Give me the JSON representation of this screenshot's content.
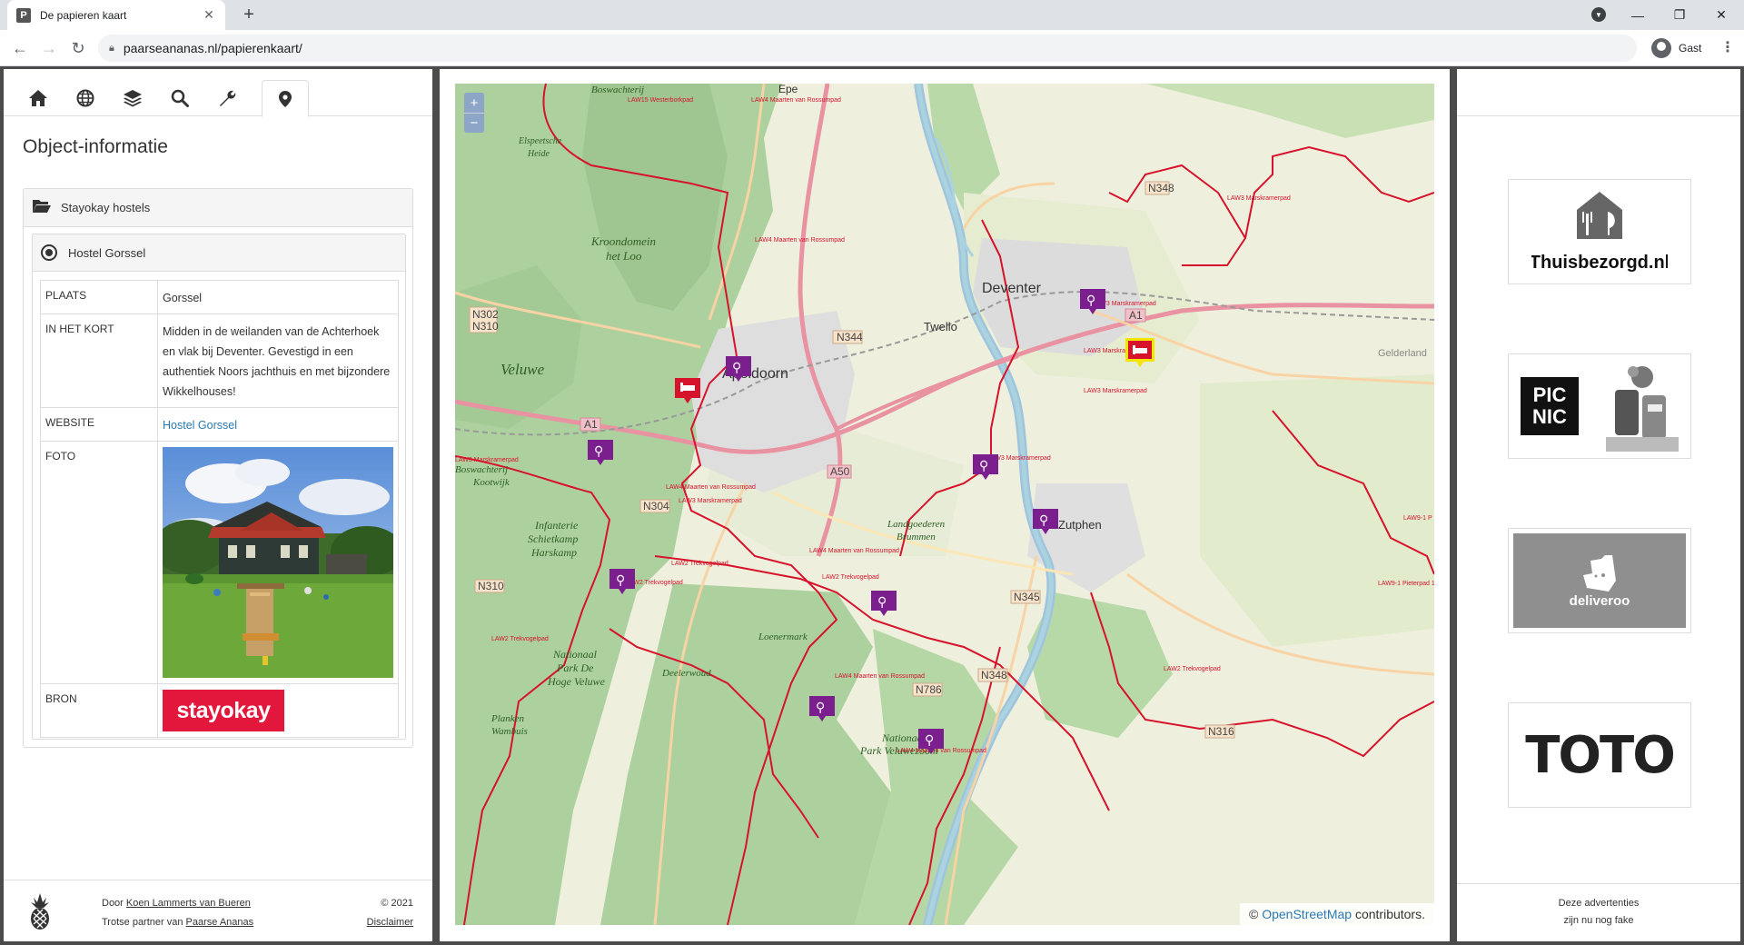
{
  "browser": {
    "tab_title": "De papieren kaart",
    "favicon_letter": "P",
    "url": "paarseananas.nl/papierenkaart/",
    "profile_name": "Gast"
  },
  "left_panel": {
    "tabs": [
      {
        "name": "home-icon"
      },
      {
        "name": "globe-icon"
      },
      {
        "name": "layers-icon"
      },
      {
        "name": "search-icon"
      },
      {
        "name": "wrench-icon"
      },
      {
        "name": "map-pin-icon",
        "active": true
      }
    ],
    "title": "Object-informatie",
    "category": "Stayokay hostels",
    "object_name": "Hostel Gorssel",
    "rows": {
      "plaats_key": "PLAATS",
      "plaats_value": "Gorssel",
      "kort_key": "IN HET KORT",
      "kort_value": "Midden in de weilanden van de Achterhoek en vlak bij Deventer. Gevestigd in een authentiek Noors jachthuis en met bijzondere Wikkelhouses!",
      "website_key": "WEBSITE",
      "website_value": "Hostel Gorssel",
      "foto_key": "FOTO",
      "bron_key": "BRON",
      "bron_logo": "stayokay"
    },
    "footer": {
      "door": "Door",
      "author": "Koen Lammerts van Bueren",
      "partner": "Trotse partner van",
      "partner_name": "Paarse Ananas",
      "year": "© 2021",
      "disclaimer": "Disclaimer"
    }
  },
  "map": {
    "zoom_in": "+",
    "zoom_out": "−",
    "attribution_prefix": "©",
    "attribution_link": "OpenStreetMap",
    "attribution_suffix": "contributors.",
    "places": [
      {
        "key": "epe",
        "label": "Epe"
      },
      {
        "key": "deventer",
        "label": "Deventer"
      },
      {
        "key": "twello",
        "label": "Twello"
      },
      {
        "key": "apeldoorn",
        "label": "Apeldoorn"
      },
      {
        "key": "zutphen",
        "label": "Zutphen"
      },
      {
        "key": "veluwe",
        "label": "Veluwe"
      },
      {
        "key": "gelderland",
        "label": "Gelderland"
      },
      {
        "key": "kroondomein",
        "label": "Kroondomein het Loo"
      },
      {
        "key": "elspeetsche",
        "label": "Elspeetsche Heide"
      },
      {
        "key": "infanterie",
        "label": "Infanterie Schietkamp Harskamp"
      },
      {
        "key": "nationaal",
        "label": "Nationaal Park De Hoge Veluwe"
      },
      {
        "key": "landgoederen",
        "label": "Landgoederen Brummen"
      },
      {
        "key": "loenermark",
        "label": "Loenermark"
      },
      {
        "key": "deelerwoud",
        "label": "Deelerwoud"
      },
      {
        "key": "planken",
        "label": "Planken Wambuis"
      },
      {
        "key": "kootwijk",
        "label": "Boswachterij Kootwijk"
      },
      {
        "key": "boswachterij",
        "label": "Boswachterij"
      },
      {
        "key": "nationaal2",
        "label": "Nationaal Park Veluwezoom"
      }
    ],
    "road_labels": [
      "N348",
      "N302",
      "N310",
      "N344",
      "A1",
      "A50",
      "N304",
      "N310",
      "N345",
      "N348",
      "N786",
      "N316",
      "A1"
    ],
    "route_labels": [
      "LAW15 Westerborkpad",
      "LAW4 Maarten van Rossumpad",
      "LAW3 Marskramerpad",
      "LAW2 Trekvogelpad",
      "LAW9-1 Pieterpad 1"
    ]
  },
  "ads": {
    "thuisbezorgd": "Thuisbezorgd.nl",
    "picnic": "PIC NIC",
    "deliveroo": "deliveroo",
    "toto": "TOTO",
    "footer_line1": "Deze advertenties",
    "footer_line2": "zijn nu nog fake"
  }
}
